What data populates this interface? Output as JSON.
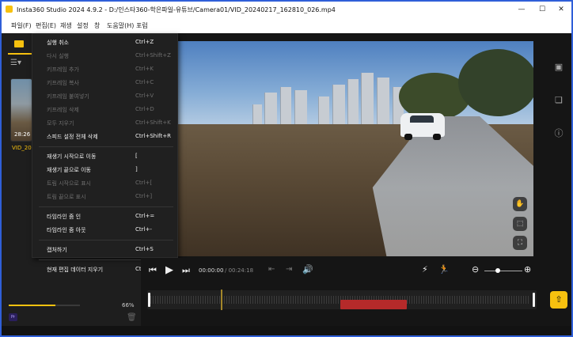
{
  "app": {
    "title": "Insta360 Studio 2024 4.9.2 - D:/인스타360-학은파일-유튜브/Camera01/VID_20240217_162810_026.mp4",
    "window_controls": [
      "—",
      "☐",
      "✕"
    ]
  },
  "menubar": {
    "items": [
      "파일(F)",
      "편집(E)",
      "재생",
      "설정",
      "창",
      "도움말(H)",
      "포럼"
    ]
  },
  "dropdown": {
    "groups": [
      [
        {
          "label": "실행 취소",
          "shortcut": "Ctrl+Z",
          "enabled": true
        },
        {
          "label": "다시 실행",
          "shortcut": "Ctrl+Shift+Z",
          "enabled": false
        },
        {
          "label": "키프레임 추가",
          "shortcut": "Ctrl+K",
          "enabled": false
        },
        {
          "label": "키프레임 복사",
          "shortcut": "Ctrl+C",
          "enabled": false
        },
        {
          "label": "키프레임 붙여넣기",
          "shortcut": "Ctrl+V",
          "enabled": false
        },
        {
          "label": "키프레임 삭제",
          "shortcut": "Ctrl+D",
          "enabled": false
        },
        {
          "label": "모두 지우기",
          "shortcut": "Ctrl+Shift+K",
          "enabled": false
        },
        {
          "label": "스피드 설정 전체 삭제",
          "shortcut": "Ctrl+Shift+R",
          "enabled": true
        }
      ],
      [
        {
          "label": "재생기 시작으로 이동",
          "shortcut": "[",
          "enabled": true
        },
        {
          "label": "재생기 끝으로 이동",
          "shortcut": "]",
          "enabled": true
        },
        {
          "label": "트림 시작으로 표시",
          "shortcut": "Ctrl+[",
          "enabled": false
        },
        {
          "label": "트림 끝으로 표시",
          "shortcut": "Ctrl+]",
          "enabled": false
        }
      ],
      [
        {
          "label": "타임라인 줌 인",
          "shortcut": "Ctrl+=",
          "enabled": true
        },
        {
          "label": "타임라인 줌 아웃",
          "shortcut": "Ctrl+-",
          "enabled": true
        }
      ],
      [
        {
          "label": "캡처하기",
          "shortcut": "Ctrl+S",
          "enabled": true
        }
      ],
      [
        {
          "label": "현재 편집 데이터 지우기",
          "shortcut": "Ctrl+Alt+R",
          "enabled": true
        }
      ]
    ]
  },
  "media": {
    "thumbnail_duration": "28:26",
    "thumbnail_name": "VID_2024",
    "progress": 66,
    "progress_label": "66%",
    "pr_badge": "Pr"
  },
  "player": {
    "current_time": "00:00:00",
    "total_time": "/ 00:24:18",
    "zoom": 0.35
  },
  "icons": {
    "prev": "skip-back-icon",
    "play": "play-icon",
    "next": "skip-forward-icon",
    "volume": "volume-icon",
    "export": "export-icon"
  },
  "colors": {
    "accent": "#f7c10f",
    "clip_segment": "#b52a2a",
    "window_border": "#2f5fd8"
  }
}
